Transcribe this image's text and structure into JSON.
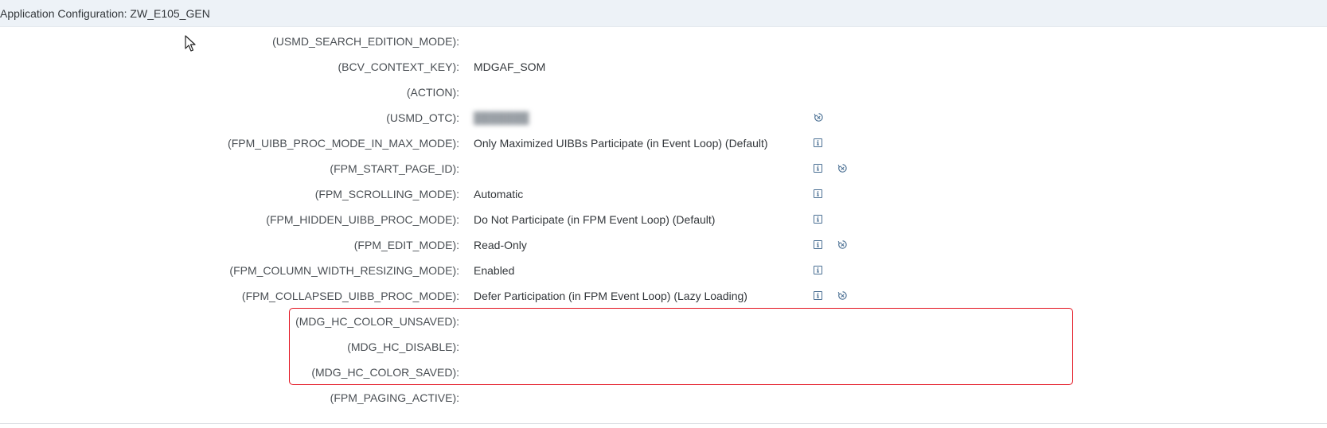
{
  "header": {
    "title": "Application Configuration: ZW_E105_GEN"
  },
  "parameters": [
    {
      "label": "(USMD_SEARCH_EDITION_MODE):",
      "value": "",
      "info": false,
      "reset": false
    },
    {
      "label": "(BCV_CONTEXT_KEY):",
      "value": "MDGAF_SOM",
      "info": false,
      "reset": false
    },
    {
      "label": "(ACTION):",
      "value": "",
      "info": false,
      "reset": false
    },
    {
      "label": "(USMD_OTC):",
      "value": "",
      "info": false,
      "reset": true,
      "value_blurred": true
    },
    {
      "label": "(FPM_UIBB_PROC_MODE_IN_MAX_MODE):",
      "value": "Only Maximized UIBBs Participate (in Event Loop) (Default)",
      "info": true,
      "reset": false
    },
    {
      "label": "(FPM_START_PAGE_ID):",
      "value": "",
      "info": true,
      "reset": true
    },
    {
      "label": "(FPM_SCROLLING_MODE):",
      "value": "Automatic",
      "info": true,
      "reset": false
    },
    {
      "label": "(FPM_HIDDEN_UIBB_PROC_MODE):",
      "value": "Do Not Participate (in FPM Event Loop) (Default)",
      "info": true,
      "reset": false
    },
    {
      "label": "(FPM_EDIT_MODE):",
      "value": "Read-Only",
      "info": true,
      "reset": true
    },
    {
      "label": "(FPM_COLUMN_WIDTH_RESIZING_MODE):",
      "value": "Enabled",
      "info": true,
      "reset": false
    },
    {
      "label": "(FPM_COLLAPSED_UIBB_PROC_MODE):",
      "value": "Defer Participation (in FPM Event Loop) (Lazy Loading)",
      "info": true,
      "reset": true
    },
    {
      "label": "(MDG_HC_COLOR_UNSAVED):",
      "value": "",
      "info": false,
      "reset": false
    },
    {
      "label": "(MDG_HC_DISABLE):",
      "value": "",
      "info": false,
      "reset": false
    },
    {
      "label": "(MDG_HC_COLOR_SAVED):",
      "value": "",
      "info": false,
      "reset": false
    },
    {
      "label": "(FPM_PAGING_ACTIVE):",
      "value": "",
      "info": false,
      "reset": false
    }
  ],
  "colors": {
    "highlight_border": "#e3101d",
    "icon_color": "#4a6f93",
    "header_bg": "#edf2f7"
  },
  "icons": {
    "info": "info-icon",
    "reset": "reset-icon",
    "cursor": "mouse-pointer-icon"
  }
}
